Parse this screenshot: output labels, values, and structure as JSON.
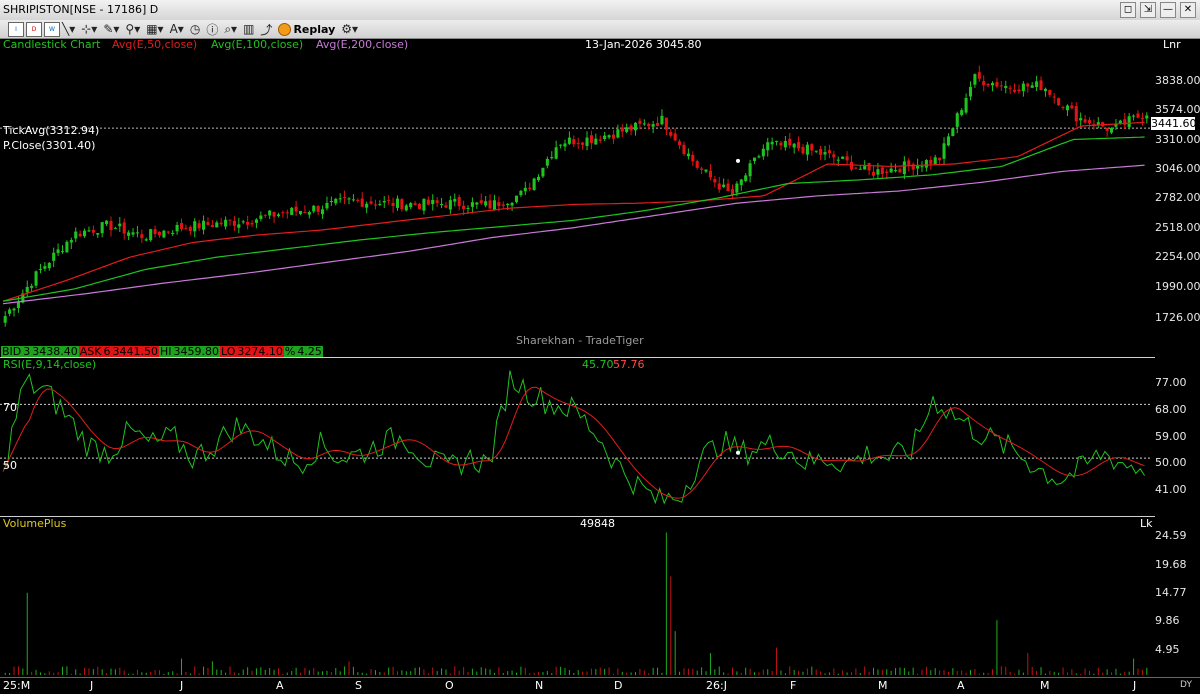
{
  "window": {
    "title": "SHRIPISTON[NSE - 17186] D",
    "controls": [
      "◻",
      "⇲",
      "—",
      "✕"
    ]
  },
  "toolbar": {
    "icons": [
      "Intraday",
      "Daily",
      "Weekly",
      "draw-line",
      "zoom",
      "settings",
      "print",
      "refresh",
      "clock",
      "search",
      "spark",
      "history"
    ],
    "replay_label": "Replay"
  },
  "price_pane": {
    "legend": [
      {
        "text": "Candlestick Chart",
        "color": "#22c322"
      },
      {
        "text": "Avg(E,50,close)",
        "color": "#e21d1d"
      },
      {
        "text": "Avg(E,100,close)",
        "color": "#1fc31f"
      },
      {
        "text": "Avg(E,200,close)",
        "color": "#c97ad8"
      }
    ],
    "crosshair_info": "13-Jan-2026 3045.80",
    "scale_mode": "Lnr",
    "tick_avg": "TickAvg(3312.94)",
    "prev_close": "P.Close(3301.40)",
    "last_price": "3441.60",
    "watermark": "Sharekhan - TradeTiger",
    "y_ticks": [
      "3838.00",
      "3574.00",
      "3310.00",
      "3046.00",
      "2782.00",
      "2518.00",
      "2254.00",
      "1990.00",
      "1726.00"
    ]
  },
  "quote_bar": {
    "bid_label": "BID",
    "bid_qty": "3",
    "bid": "3438.40",
    "ask_label": "ASK",
    "ask_qty": "6",
    "ask": "3441.50",
    "hi_label": "HI",
    "hi": "3459.80",
    "lo_label": "LO",
    "lo": "3274.10",
    "pct_label": "%",
    "pct": "4.25"
  },
  "rsi_pane": {
    "legend": "RSI(E,9,14,close)",
    "value1": "45.70",
    "value2": "57.76",
    "level_high": "70",
    "level_low": "50",
    "y_ticks": [
      "77.00",
      "68.00",
      "59.00",
      "50.00",
      "41.00"
    ]
  },
  "volume_pane": {
    "legend": "VolumePlus",
    "value": "49848",
    "unit": "Lk",
    "y_ticks": [
      "24.59",
      "19.68",
      "14.77",
      "9.86",
      "4.95"
    ]
  },
  "x_axis": {
    "labels": [
      "25:M",
      "J",
      "J",
      "A",
      "S",
      "O",
      "N",
      "D",
      "26:J",
      "F",
      "M",
      "A",
      "M",
      "J"
    ],
    "corner": "DY"
  },
  "colors": {
    "up": "#1fc31f",
    "down": "#e01414",
    "ema50": "#e21d1d",
    "ema100": "#1fc31f",
    "ema200": "#c97ad8",
    "rsi": "#1fc31f",
    "rsi_signal": "#e21d1d",
    "volume_up": "#1fae1f",
    "volume_down": "#c01414"
  },
  "chart_data": {
    "type": "candlestick",
    "title": "SHRIPISTON[NSE - 17186] D",
    "x_months": [
      "M 2025",
      "J",
      "J",
      "A",
      "S",
      "O",
      "N",
      "D",
      "J 2026",
      "F",
      "M",
      "A",
      "M",
      "J"
    ],
    "ylim": [
      1600,
      3950
    ],
    "close_approx": [
      1780,
      2150,
      2450,
      2520,
      2430,
      2500,
      2530,
      2560,
      2620,
      2660,
      2720,
      2700,
      2690,
      2700,
      2680,
      2780,
      3200,
      3230,
      3300,
      3380,
      3000,
      2760,
      3180,
      3150,
      3070,
      2950,
      3000,
      3060,
      3720,
      3650,
      3660,
      3400,
      3300,
      3441.6
    ],
    "series": [
      {
        "name": "Avg(E,50,close)",
        "values_approx": [
          1900,
          2070,
          2260,
          2380,
          2440,
          2480,
          2540,
          2600,
          2660,
          2690,
          2700,
          2720,
          2760,
          3020,
          3000,
          3020,
          3080,
          3330,
          3360
        ]
      },
      {
        "name": "Avg(E,100,close)",
        "values_approx": [
          1900,
          2000,
          2160,
          2260,
          2330,
          2400,
          2460,
          2510,
          2560,
          2640,
          2740,
          2860,
          2890,
          2930,
          3000,
          3220,
          3240
        ]
      },
      {
        "name": "Avg(E,200,close)",
        "values_approx": [
          1880,
          1960,
          2050,
          2130,
          2220,
          2310,
          2420,
          2500,
          2600,
          2700,
          2760,
          2800,
          2870,
          2960,
          3010
        ]
      }
    ],
    "rsi": {
      "name": "RSI(E,9,14,close)",
      "ylim": [
        30,
        85
      ],
      "levels": [
        70,
        50
      ],
      "last": 45.7,
      "signal_last": 57.76
    },
    "volume": {
      "name": "VolumePlus",
      "unit": "Lk",
      "ylim": [
        0,
        27
      ],
      "last": 49848
    }
  }
}
